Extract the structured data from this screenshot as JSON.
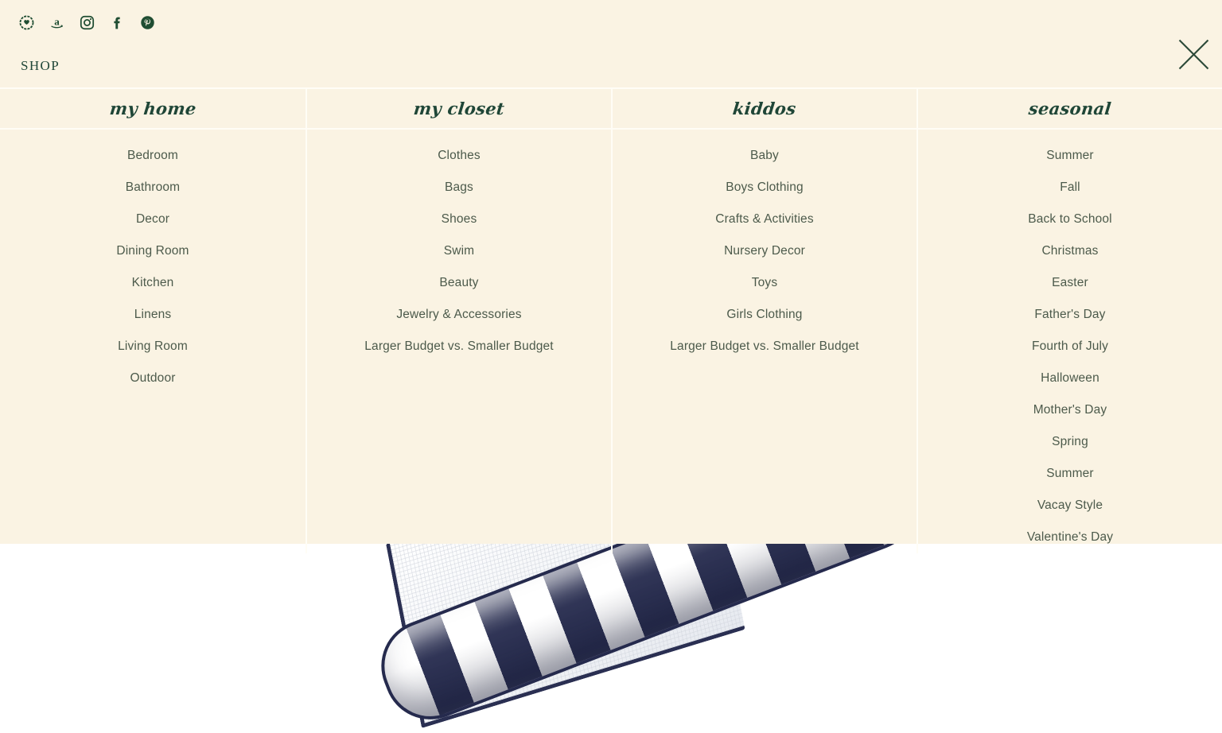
{
  "colors": {
    "panel_bg": "#faf3e3",
    "divider": "#fffdf6",
    "accent_green": "#1f4637",
    "item_text": "#4c5a4b",
    "page_bg": "#ffffff",
    "photo_navy": "#252a4d"
  },
  "header": {
    "shop_label": "SHOP",
    "close_label": "Close menu",
    "social": [
      {
        "name": "ltk-icon",
        "label": "LTK"
      },
      {
        "name": "amazon-icon",
        "label": "Amazon"
      },
      {
        "name": "instagram-icon",
        "label": "Instagram"
      },
      {
        "name": "facebook-icon",
        "label": "Facebook"
      },
      {
        "name": "pinterest-icon",
        "label": "Pinterest"
      }
    ]
  },
  "menu": {
    "columns": [
      {
        "title": "my home",
        "items": [
          "Bedroom",
          "Bathroom",
          "Decor",
          "Dining Room",
          "Kitchen",
          "Linens",
          "Living Room",
          "Outdoor"
        ]
      },
      {
        "title": "my closet",
        "items": [
          "Clothes",
          "Bags",
          "Shoes",
          "Swim",
          "Beauty",
          "Jewelry & Accessories",
          "Larger Budget vs. Smaller Budget"
        ]
      },
      {
        "title": "kiddos",
        "items": [
          "Baby",
          "Boys Clothing",
          "Crafts & Activities",
          "Nursery Decor",
          "Toys",
          "Girls Clothing",
          "Larger Budget vs. Smaller Budget"
        ]
      },
      {
        "title": "seasonal",
        "items": [
          "Summer",
          "Fall",
          "Back to School",
          "Christmas",
          "Easter",
          "Father's Day",
          "Fourth of July",
          "Halloween",
          "Mother's Day",
          "Spring",
          "Summer",
          "Vacay Style",
          "Valentine's Day"
        ]
      }
    ]
  },
  "background_content": {
    "description": "navy and white striped bolster pillow on white textured outdoor cushion"
  }
}
